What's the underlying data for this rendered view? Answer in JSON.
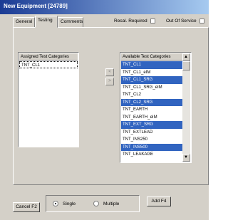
{
  "window": {
    "title": "New Equipment [24789]"
  },
  "tabs": [
    {
      "label": "General"
    },
    {
      "label": "Testing"
    },
    {
      "label": "Comments"
    }
  ],
  "flags": {
    "recal_label": "Recal. Required",
    "out_of_service_label": "Out Of Service"
  },
  "assigned": {
    "header": "Assigned Test Categories",
    "items": [
      "TNT_CL1"
    ]
  },
  "available": {
    "header": "Available Test Categories",
    "items": [
      {
        "label": "TNT_CL1",
        "selected": true
      },
      {
        "label": "TNT_CL1_eIM",
        "selected": false
      },
      {
        "label": "TNT_CL1_SRG",
        "selected": true
      },
      {
        "label": "TNT_CL1_SRG_eIM",
        "selected": false
      },
      {
        "label": "TNT_CL2",
        "selected": false
      },
      {
        "label": "TNT_CL2_SRG",
        "selected": true
      },
      {
        "label": "TNT_EARTH",
        "selected": false
      },
      {
        "label": "TNT_EARTH_eIM",
        "selected": false
      },
      {
        "label": "TNT_EXT_SRG",
        "selected": true
      },
      {
        "label": "TNT_EXTLEAD",
        "selected": false
      },
      {
        "label": "TNT_INS250",
        "selected": false
      },
      {
        "label": "TNT_INS500",
        "selected": true
      },
      {
        "label": "TNT_LEAKAGE",
        "selected": false
      }
    ]
  },
  "transfer": {
    "left_glyph": "<",
    "right_glyph": ">"
  },
  "footer": {
    "cancel_label": "Cancel F2",
    "add_label": "Add F4",
    "mode_single": "Single",
    "mode_multiple": "Multiple",
    "mode_selected": "single"
  },
  "colors": {
    "title_bar": "#1b3b94",
    "selection": "#3164c0",
    "window_bg": "#d4d0c8"
  }
}
